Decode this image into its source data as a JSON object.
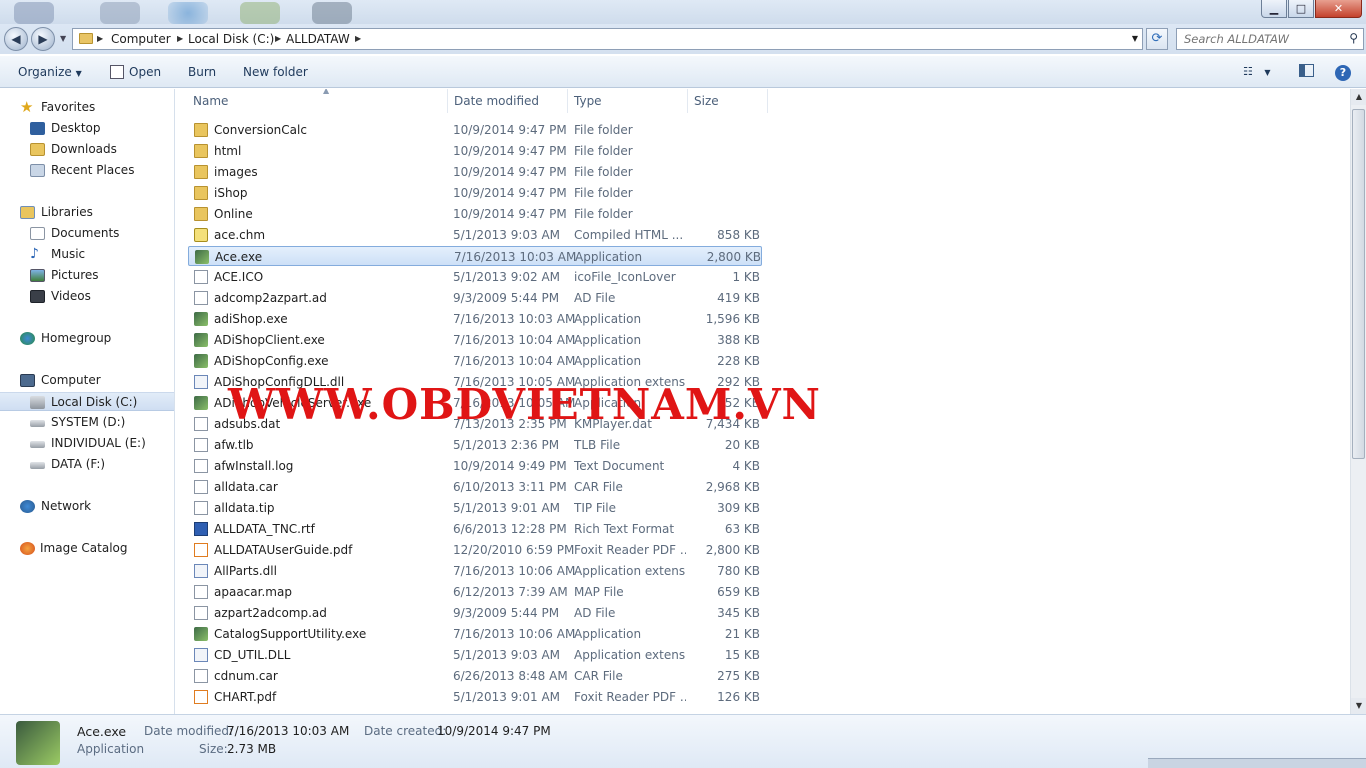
{
  "window": {
    "minimize": "▁",
    "maximize": "□",
    "close": "✕"
  },
  "nav": {
    "back_icon": "back-arrow-icon",
    "forward_icon": "forward-arrow-icon"
  },
  "address": {
    "crumbs": [
      "Computer",
      "Local Disk (C:)",
      "ALLDATAW"
    ]
  },
  "search": {
    "placeholder": "Search ALLDATAW"
  },
  "toolbar": {
    "organize": "Organize",
    "open": "Open",
    "burn": "Burn",
    "new_folder": "New folder"
  },
  "sidebar": {
    "items": [
      {
        "label": "Favorites"
      },
      {
        "label": "Desktop"
      },
      {
        "label": "Downloads"
      },
      {
        "label": "Recent Places"
      },
      {
        "label": "Libraries"
      },
      {
        "label": "Documents"
      },
      {
        "label": "Music"
      },
      {
        "label": "Pictures"
      },
      {
        "label": "Videos"
      },
      {
        "label": "Homegroup"
      },
      {
        "label": "Computer"
      },
      {
        "label": "Local Disk (C:)"
      },
      {
        "label": "SYSTEM (D:)"
      },
      {
        "label": "INDIVIDUAL (E:)"
      },
      {
        "label": "DATA (F:)"
      },
      {
        "label": "Network"
      },
      {
        "label": "Image Catalog"
      }
    ]
  },
  "columns": {
    "name": "Name",
    "date": "Date modified",
    "type": "Type",
    "size": "Size"
  },
  "files": [
    {
      "name": "ConversionCalc",
      "date": "10/9/2014 9:47 PM",
      "type": "File folder",
      "size": ""
    },
    {
      "name": "html",
      "date": "10/9/2014 9:47 PM",
      "type": "File folder",
      "size": ""
    },
    {
      "name": "images",
      "date": "10/9/2014 9:47 PM",
      "type": "File folder",
      "size": ""
    },
    {
      "name": "iShop",
      "date": "10/9/2014 9:47 PM",
      "type": "File folder",
      "size": ""
    },
    {
      "name": "Online",
      "date": "10/9/2014 9:47 PM",
      "type": "File folder",
      "size": ""
    },
    {
      "name": "ace.chm",
      "date": "5/1/2013 9:03 AM",
      "type": "Compiled HTML ...",
      "size": "858 KB"
    },
    {
      "name": "Ace.exe",
      "date": "7/16/2013 10:03 AM",
      "type": "Application",
      "size": "2,800 KB"
    },
    {
      "name": "ACE.ICO",
      "date": "5/1/2013 9:02 AM",
      "type": "icoFile_IconLover",
      "size": "1 KB"
    },
    {
      "name": "adcomp2azpart.ad",
      "date": "9/3/2009 5:44 PM",
      "type": "AD File",
      "size": "419 KB"
    },
    {
      "name": "adiShop.exe",
      "date": "7/16/2013 10:03 AM",
      "type": "Application",
      "size": "1,596 KB"
    },
    {
      "name": "ADiShopClient.exe",
      "date": "7/16/2013 10:04 AM",
      "type": "Application",
      "size": "388 KB"
    },
    {
      "name": "ADiShopConfig.exe",
      "date": "7/16/2013 10:04 AM",
      "type": "Application",
      "size": "228 KB"
    },
    {
      "name": "ADiShopConfigDLL.dll",
      "date": "7/16/2013 10:05 AM",
      "type": "Application extens...",
      "size": "292 KB"
    },
    {
      "name": "ADiShopVehicleServer.exe",
      "date": "7/16/2013 10:05 AM",
      "type": "Application",
      "size": "152 KB"
    },
    {
      "name": "adsubs.dat",
      "date": "7/13/2013 2:35 PM",
      "type": "KMPlayer.dat",
      "size": "7,434 KB"
    },
    {
      "name": "afw.tlb",
      "date": "5/1/2013 2:36 PM",
      "type": "TLB File",
      "size": "20 KB"
    },
    {
      "name": "afwInstall.log",
      "date": "10/9/2014 9:49 PM",
      "type": "Text Document",
      "size": "4 KB"
    },
    {
      "name": "alldata.car",
      "date": "6/10/2013 3:11 PM",
      "type": "CAR File",
      "size": "2,968 KB"
    },
    {
      "name": "alldata.tip",
      "date": "5/1/2013 9:01 AM",
      "type": "TIP File",
      "size": "309 KB"
    },
    {
      "name": "ALLDATA_TNC.rtf",
      "date": "6/6/2013 12:28 PM",
      "type": "Rich Text Format",
      "size": "63 KB"
    },
    {
      "name": "ALLDATAUserGuide.pdf",
      "date": "12/20/2010 6:59 PM",
      "type": "Foxit Reader PDF ...",
      "size": "2,800 KB"
    },
    {
      "name": "AllParts.dll",
      "date": "7/16/2013 10:06 AM",
      "type": "Application extens...",
      "size": "780 KB"
    },
    {
      "name": "apaacar.map",
      "date": "6/12/2013 7:39 AM",
      "type": "MAP File",
      "size": "659 KB"
    },
    {
      "name": "azpart2adcomp.ad",
      "date": "9/3/2009 5:44 PM",
      "type": "AD File",
      "size": "345 KB"
    },
    {
      "name": "CatalogSupportUtility.exe",
      "date": "7/16/2013 10:06 AM",
      "type": "Application",
      "size": "21 KB"
    },
    {
      "name": "CD_UTIL.DLL",
      "date": "5/1/2013 9:03 AM",
      "type": "Application extens...",
      "size": "15 KB"
    },
    {
      "name": "cdnum.car",
      "date": "6/26/2013 8:48 AM",
      "type": "CAR File",
      "size": "275 KB"
    },
    {
      "name": "CHART.pdf",
      "date": "5/1/2013 9:01 AM",
      "type": "Foxit Reader PDF ...",
      "size": "126 KB"
    }
  ],
  "watermark": "WWW.OBDVIETNAM.VN",
  "details": {
    "name": "Ace.exe",
    "kind": "Application",
    "modified_label": "Date modified:",
    "modified_value": "7/16/2013 10:03 AM",
    "created_label": "Date created:",
    "created_value": "10/9/2014 9:47 PM",
    "size_label": "Size:",
    "size_value": "2.73 MB"
  },
  "colors": {
    "accent": "#1e395b",
    "selection": "#cde0f7",
    "watermark": "#e01515"
  }
}
